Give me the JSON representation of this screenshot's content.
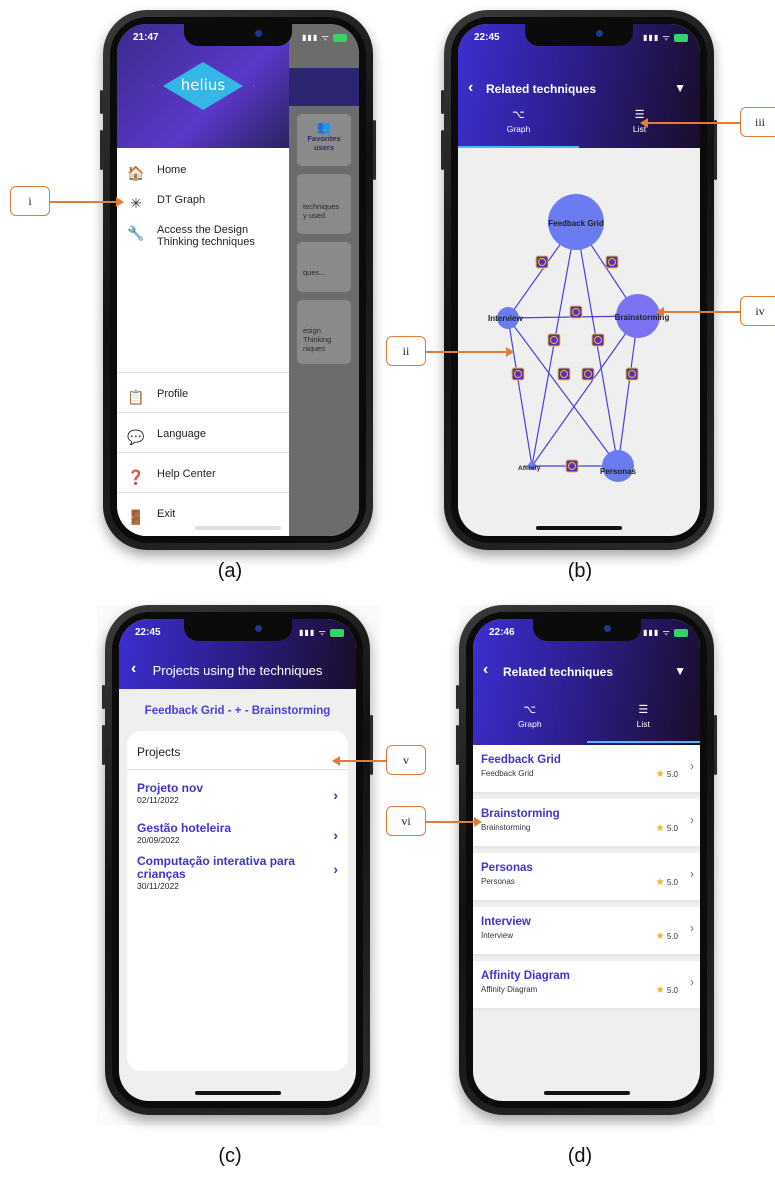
{
  "captions": {
    "a": "(a)",
    "b": "(b)",
    "c": "(c)",
    "d": "(d)"
  },
  "callouts": {
    "i": "i",
    "ii": "ii",
    "iii": "iii",
    "iv": "iv",
    "v": "v",
    "vi": "vi"
  },
  "status": {
    "a_time": "21:47",
    "b_time": "22:45",
    "c_time": "22:45",
    "d_time": "22:46"
  },
  "panel_a": {
    "logo_text": "helius",
    "menu": [
      {
        "label": "Home",
        "icon": "home-icon"
      },
      {
        "label": "DT Graph",
        "icon": "graph-icon"
      },
      {
        "label": "Access the Design Thinking techniques",
        "icon": "tools-icon"
      }
    ],
    "bottom_menu": [
      {
        "label": "Profile",
        "icon": "profile-icon"
      },
      {
        "label": "Language",
        "icon": "language-icon"
      },
      {
        "label": "Help Center",
        "icon": "help-icon"
      },
      {
        "label": "Exit",
        "icon": "exit-icon"
      }
    ],
    "background_cards": [
      "Favorites users",
      "techniques y used",
      "ques...",
      "esign Thinking niques"
    ]
  },
  "panel_b": {
    "title": "Related techniques",
    "tabs": [
      {
        "label": "Graph",
        "icon": "graph-tab-icon"
      },
      {
        "label": "List",
        "icon": "list-tab-icon"
      }
    ],
    "nodes": [
      "Feedback Grid",
      "Interview",
      "Brainstorming",
      "Affinity",
      "Personas"
    ]
  },
  "panel_c": {
    "title": "Projects using the techniques",
    "subtitle": "Feedback Grid  - + -  Brainstorming",
    "section": "Projects",
    "projects": [
      {
        "name": "Projeto nov",
        "date": "02/11/2022"
      },
      {
        "name": "Gestão hoteleira",
        "date": "20/09/2022"
      },
      {
        "name": "Computação interativa para crianças",
        "date": "30/11/2022"
      }
    ]
  },
  "panel_d": {
    "title": "Related techniques",
    "tabs": [
      {
        "label": "Graph",
        "icon": "graph-tab-icon"
      },
      {
        "label": "List",
        "icon": "list-tab-icon"
      }
    ],
    "items": [
      {
        "title": "Feedback Grid",
        "subtitle": "Feedback Grid",
        "rating": "5.0"
      },
      {
        "title": "Brainstorming",
        "subtitle": "Brainstorming",
        "rating": "5.0"
      },
      {
        "title": "Personas",
        "subtitle": "Personas",
        "rating": "5.0"
      },
      {
        "title": "Interview",
        "subtitle": "Interview",
        "rating": "5.0"
      },
      {
        "title": "Affinity Diagram",
        "subtitle": "Affinity Diagram",
        "rating": "5.0"
      }
    ]
  },
  "colors": {
    "accent": "#3f35cc",
    "callout": "#e07b39",
    "node": "#6a7cf0"
  }
}
